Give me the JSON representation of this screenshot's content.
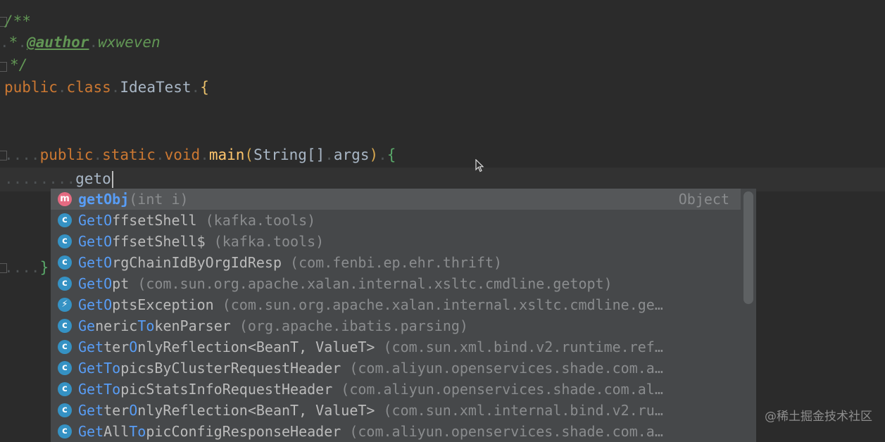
{
  "editor": {
    "lines": {
      "l1": {
        "open": "/**"
      },
      "l2": {
        "star": "*",
        "tag": "@author",
        "name": "wxweven"
      },
      "l3": {
        "close": "*/"
      },
      "l4": {
        "public": "public",
        "class": "class",
        "name": "IdeaTest",
        "brace": "{"
      },
      "l6": {
        "public": "public",
        "static": "static",
        "void": "void",
        "method": "main",
        "lp": "(",
        "type": "String[]",
        "arg": "args",
        "rp": ")",
        "brace": "{"
      },
      "l7": {
        "typed": "geto"
      },
      "l8": {
        "brace": "}"
      }
    }
  },
  "completion": {
    "items": [
      {
        "icon": "m",
        "icon_name": "method-icon",
        "match": "getO",
        "rest": "bj",
        "params": "(int i)",
        "type": "Object"
      },
      {
        "icon": "c",
        "icon_name": "class-icon",
        "pre": "",
        "m1": "GetO",
        "mid": "ffsetShell",
        "m2": "",
        "tail": "",
        "pkg": "(kafka.tools)"
      },
      {
        "icon": "c",
        "icon_name": "class-icon",
        "pre": "",
        "m1": "GetO",
        "mid": "ffsetShell$",
        "m2": "",
        "tail": "",
        "pkg": "(kafka.tools)"
      },
      {
        "icon": "c",
        "icon_name": "class-icon",
        "pre": "",
        "m1": "GetO",
        "mid": "rgChainIdByOrgIdResp",
        "m2": "",
        "tail": "",
        "pkg": "(com.fenbi.ep.ehr.thrift)"
      },
      {
        "icon": "c",
        "icon_name": "class-icon",
        "pre": "",
        "m1": "GetO",
        "mid": "pt",
        "m2": "",
        "tail": "",
        "pkg": "(com.sun.org.apache.xalan.internal.xsltc.cmdline.getopt)"
      },
      {
        "icon": "e",
        "icon_name": "exception-icon",
        "pre": "",
        "m1": "GetO",
        "mid": "ptsException",
        "m2": "",
        "tail": "",
        "pkg": "(com.sun.org.apache.xalan.internal.xsltc.cmdline.ge…"
      },
      {
        "icon": "c",
        "icon_name": "class-icon",
        "pre": "",
        "m1": "Ge",
        "mid": "neric",
        "m2": "To",
        "tail": "kenParser",
        "pkg": "(org.apache.ibatis.parsing)"
      },
      {
        "icon": "c",
        "icon_name": "class-icon",
        "pre": "",
        "m1": "Get",
        "mid": "ter",
        "m2": "O",
        "tail": "nlyReflection<BeanT, ValueT>",
        "pkg": "(com.sun.xml.bind.v2.runtime.ref…"
      },
      {
        "icon": "c",
        "icon_name": "class-icon",
        "pre": "",
        "m1": "GetTo",
        "mid": "picsByClusterRequestHeader",
        "m2": "",
        "tail": "",
        "pkg": "(com.aliyun.openservices.shade.com.a…"
      },
      {
        "icon": "c",
        "icon_name": "class-icon",
        "pre": "",
        "m1": "GetTo",
        "mid": "picStatsInfoRequestHeader",
        "m2": "",
        "tail": "",
        "pkg": "(com.aliyun.openservices.shade.com.al…"
      },
      {
        "icon": "c",
        "icon_name": "class-icon",
        "pre": "",
        "m1": "Get",
        "mid": "ter",
        "m2": "O",
        "tail": "nlyReflection<BeanT, ValueT>",
        "pkg": "(com.sun.xml.internal.bind.v2.ru…"
      },
      {
        "icon": "c",
        "icon_name": "class-icon",
        "pre": "",
        "m1": "Get",
        "mid": "All",
        "m2": "To",
        "tail": "picConfigResponseHeader",
        "pkg": "(com.aliyun.openservices.shade.com.a…"
      }
    ]
  },
  "watermark": "@稀土掘金技术社区",
  "colors": {
    "background": "#2b2b2b",
    "popup": "#46484a",
    "selected": "#555759",
    "match": "#589df6"
  }
}
